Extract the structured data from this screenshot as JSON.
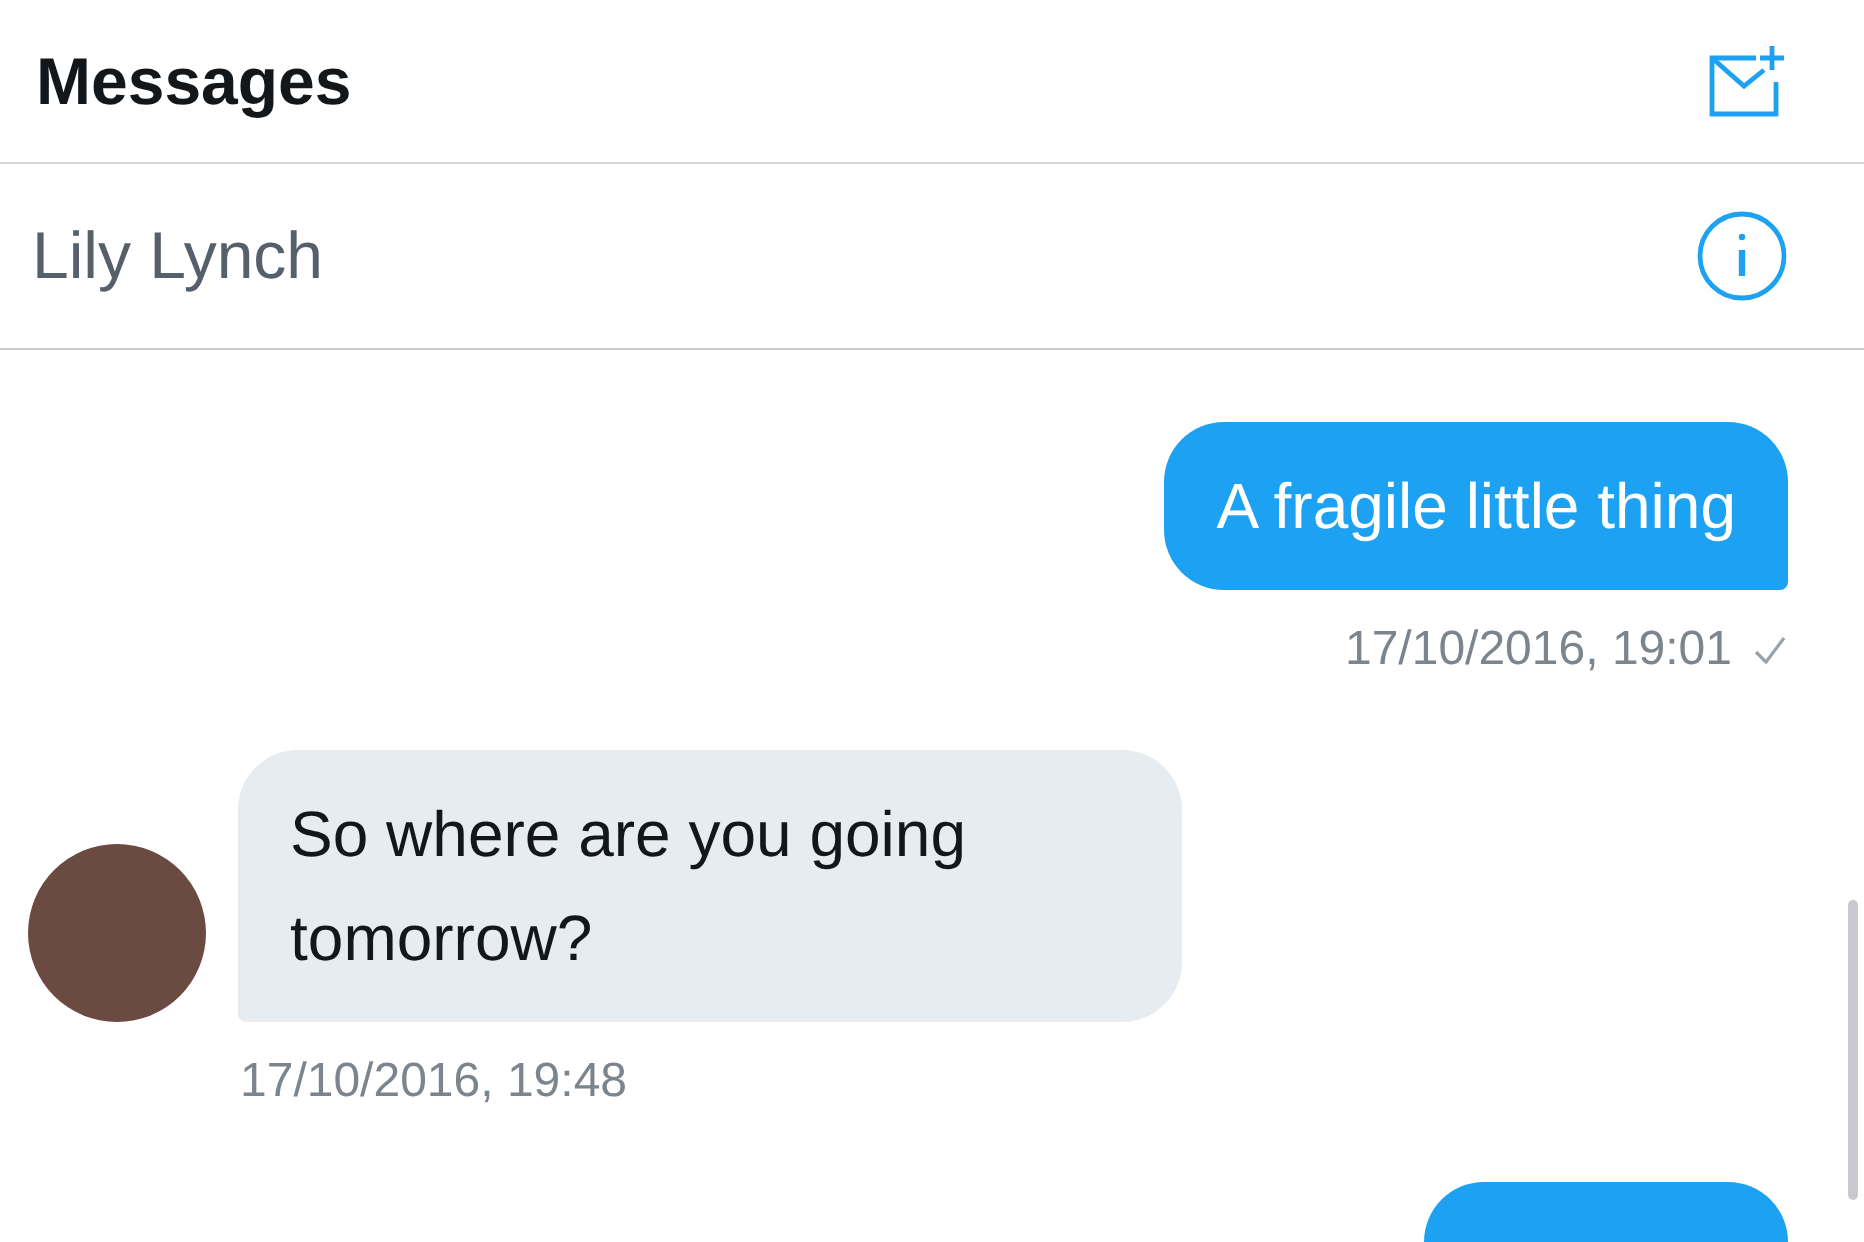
{
  "header": {
    "title": "Messages"
  },
  "conversation": {
    "contact_name": "Lily Lynch"
  },
  "messages": [
    {
      "kind": "sent",
      "text": "A fragile little thing",
      "time": "17/10/2016, 19:01",
      "delivered": true
    },
    {
      "kind": "received",
      "text": "So where are you going tomorrow?",
      "time": "17/10/2016, 19:48"
    },
    {
      "kind": "sent"
    }
  ]
}
